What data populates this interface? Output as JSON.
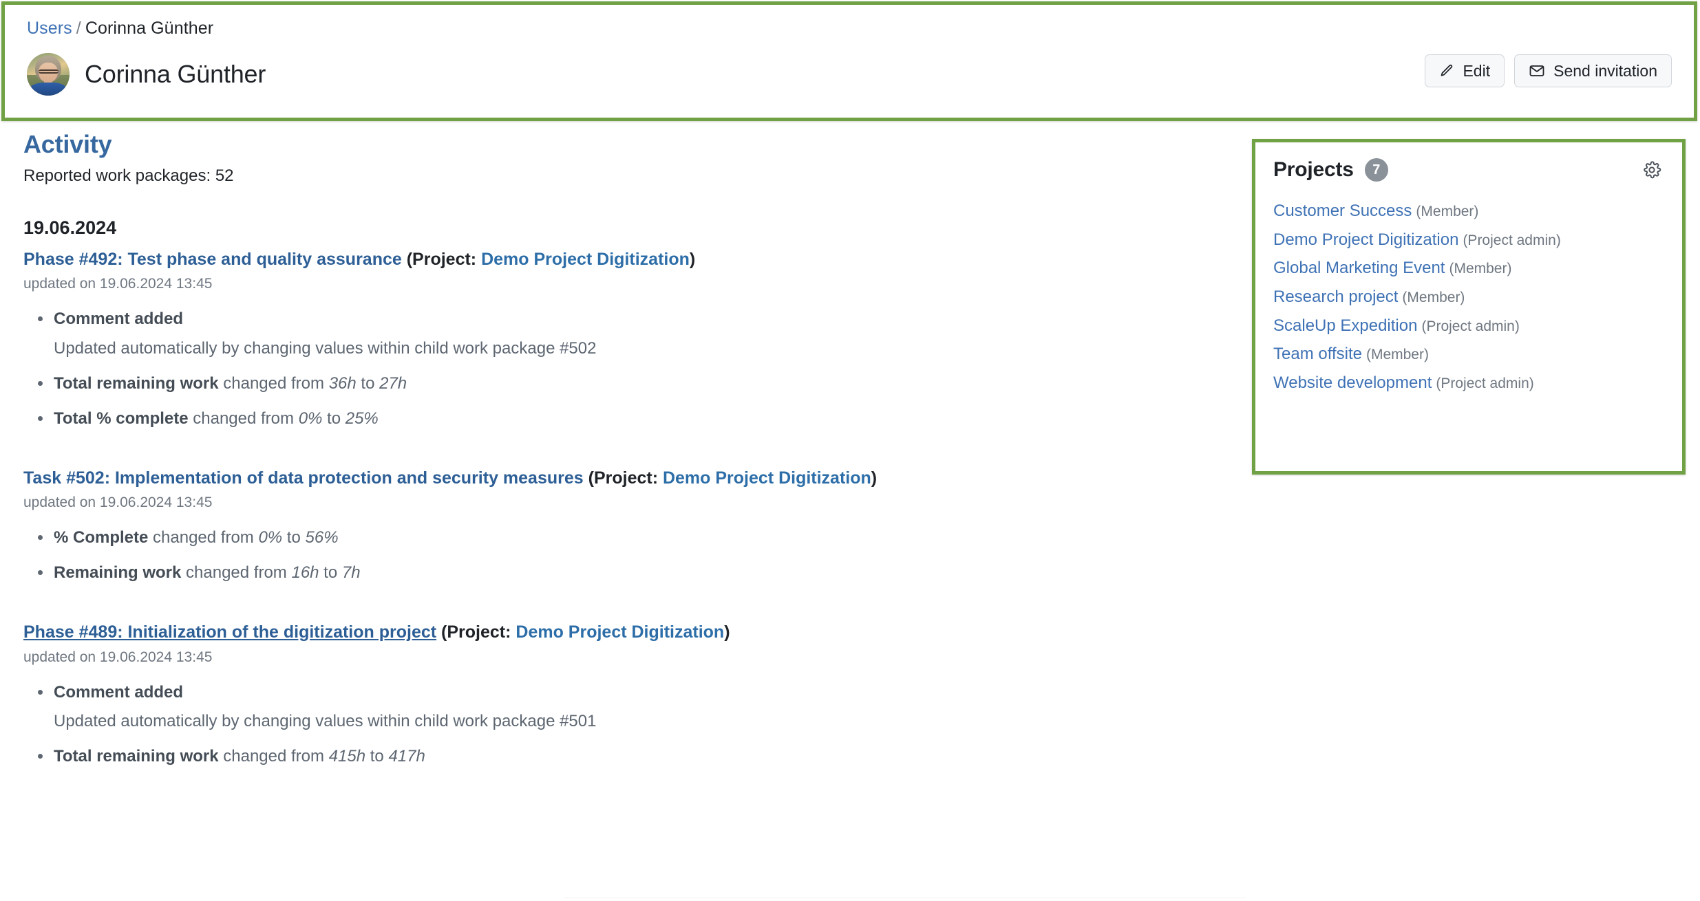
{
  "header": {
    "breadcrumb": {
      "parent": "Users",
      "separator": "/",
      "current": "Corinna Günther"
    },
    "user_name": "Corinna Günther",
    "avatar_alt": "Corinna Günther",
    "buttons": [
      {
        "label": "Edit",
        "icon": "pencil-icon"
      },
      {
        "label": "Send invitation",
        "icon": "envelope-icon"
      }
    ],
    "accent_outline_color": "#70a144"
  },
  "activity": {
    "title": "Activity",
    "title_color": "#36689f",
    "reported": "Reported work packages: 52",
    "date_heading": "19.06.2024",
    "entries": [
      {
        "wp_title": "Phase #492: Test phase and quality assurance",
        "project_prefix": "(Project: ",
        "project_name": "Demo Project Digitization",
        "project_suffix": ")",
        "meta": "updated on 19.06.2024 13:45",
        "hovered": false,
        "changes": [
          {
            "label": "Comment added",
            "rest": "",
            "detail": "Updated automatically by changing values within child work package #502"
          },
          {
            "label": "Total remaining work",
            "mid1": " changed from ",
            "old": "36h",
            "mid2": " to ",
            "new": "27h"
          },
          {
            "label": "Total % complete",
            "mid1": " changed from ",
            "old": "0%",
            "mid2": " to ",
            "new": "25%"
          }
        ]
      },
      {
        "wp_title": "Task #502: Implementation of data protection and security measures",
        "project_prefix": "(Project: ",
        "project_name": "Demo Project Digitization",
        "project_suffix": ")",
        "meta": "updated on 19.06.2024 13:45",
        "hovered": false,
        "changes": [
          {
            "label": "% Complete",
            "mid1": " changed from ",
            "old": "0%",
            "mid2": " to ",
            "new": "56%"
          },
          {
            "label": "Remaining work",
            "mid1": " changed from ",
            "old": "16h",
            "mid2": " to ",
            "new": "7h"
          }
        ]
      },
      {
        "wp_title": "Phase #489: Initialization of the digitization project",
        "project_prefix": "(Project: ",
        "project_name": "Demo Project Digitization",
        "project_suffix": ")",
        "meta": "updated on 19.06.2024 13:45",
        "hovered": true,
        "changes": [
          {
            "label": "Comment added",
            "rest": "",
            "detail": "Updated automatically by changing values within child work package #501"
          },
          {
            "label": "Total remaining work",
            "mid1": " changed from ",
            "old": "415h",
            "mid2": " to ",
            "new": "417h"
          }
        ]
      }
    ]
  },
  "projects_panel": {
    "title": "Projects",
    "count": "7",
    "settings_icon": "gear-icon",
    "items": [
      {
        "name": "Customer Success",
        "role": "(Member)"
      },
      {
        "name": "Demo Project Digitization",
        "role": "(Project admin)"
      },
      {
        "name": "Global Marketing Event",
        "role": "(Member)"
      },
      {
        "name": "Research project",
        "role": "(Member)"
      },
      {
        "name": "ScaleUp Expedition",
        "role": "(Project admin)"
      },
      {
        "name": "Team offsite",
        "role": "(Member)"
      },
      {
        "name": "Website development",
        "role": "(Project admin)"
      }
    ]
  }
}
